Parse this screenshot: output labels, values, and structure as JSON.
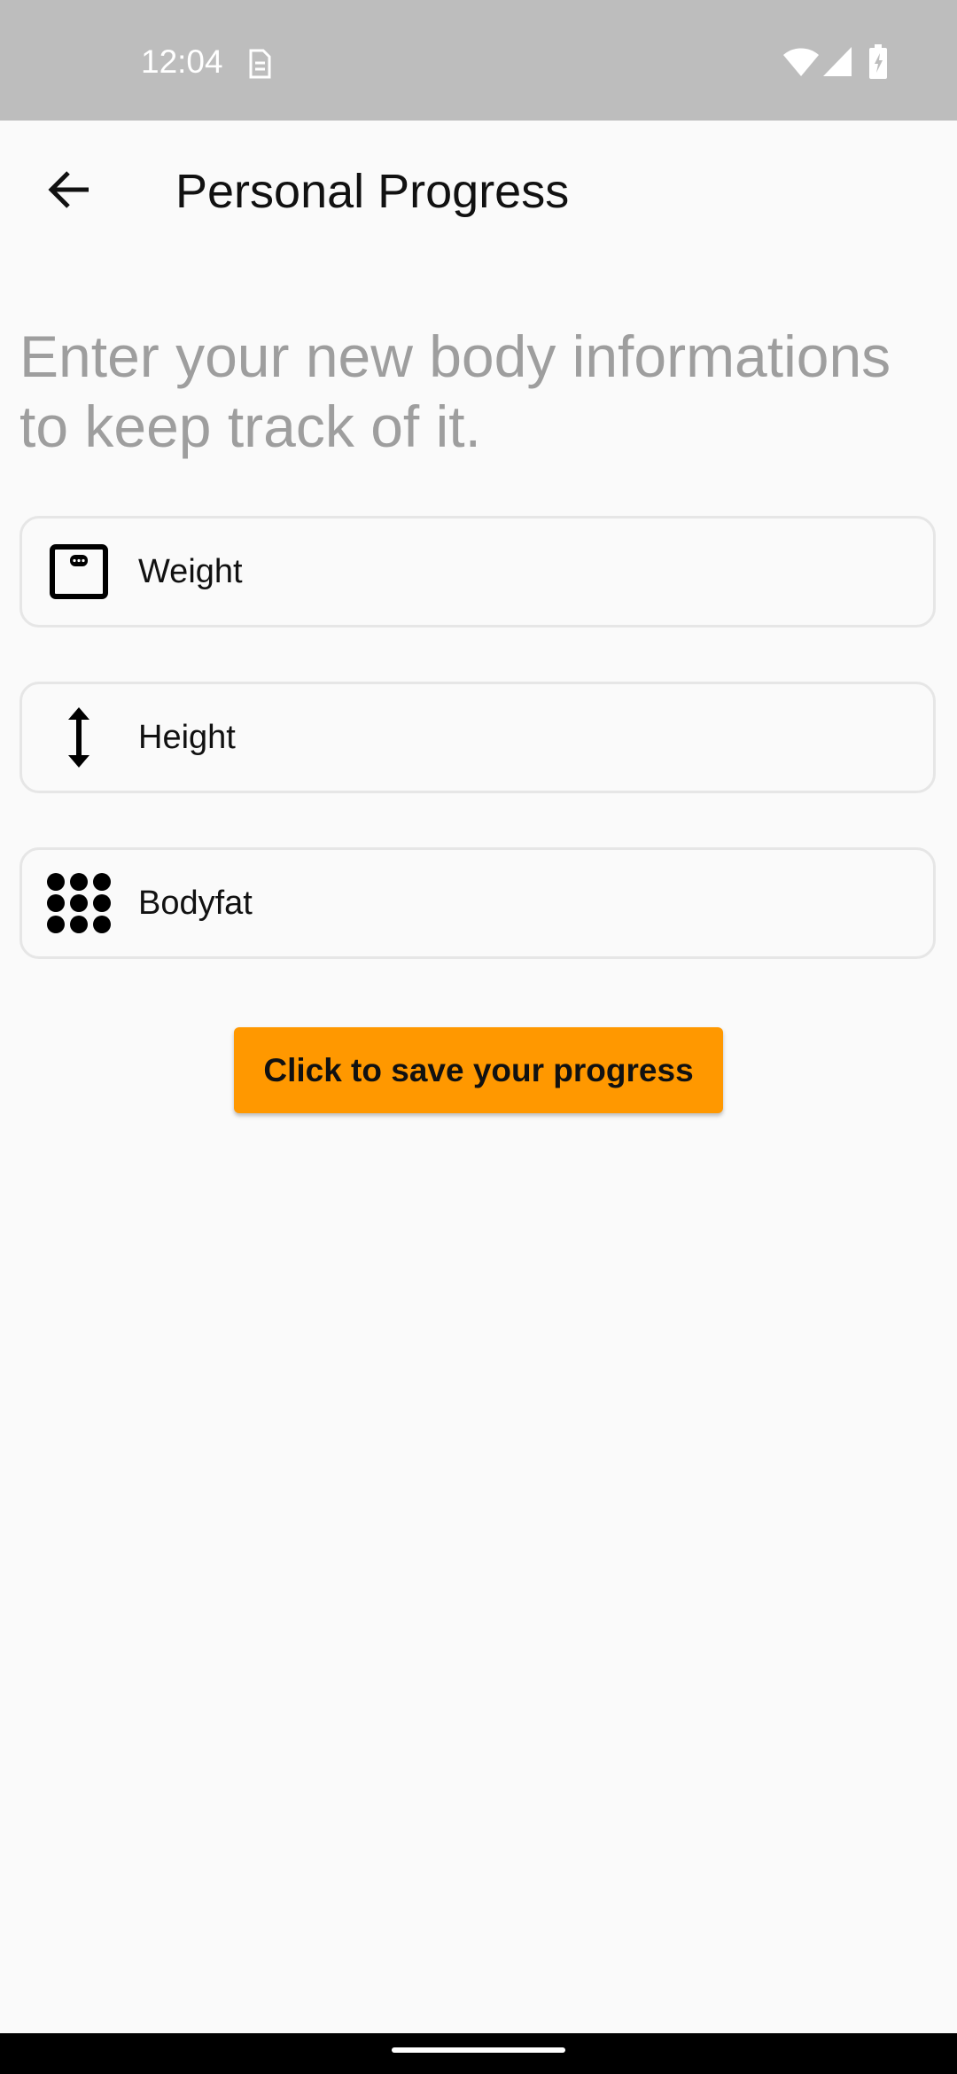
{
  "status_bar": {
    "time": "12:04",
    "icons": [
      "sim-card-icon",
      "wifi-icon",
      "signal-icon",
      "battery-charging-icon"
    ]
  },
  "app_bar": {
    "back_icon": "arrow-back-icon",
    "title": "Personal Progress"
  },
  "intro_text": "Enter your new body informations to keep track of it.",
  "fields": {
    "weight": {
      "icon": "scale-icon",
      "label": "Weight"
    },
    "height": {
      "icon": "height-arrow-icon",
      "label": "Height"
    },
    "bodyfat": {
      "icon": "dots-grid-icon",
      "label": "Bodyfat"
    }
  },
  "save_button": {
    "label": "Click to save your progress",
    "color": "#FF9800"
  },
  "colors": {
    "status_bar": "#BDBDBD",
    "background": "#FAFAFA",
    "intro_text": "#9E9E9E",
    "field_border": "#E6E6E6"
  }
}
